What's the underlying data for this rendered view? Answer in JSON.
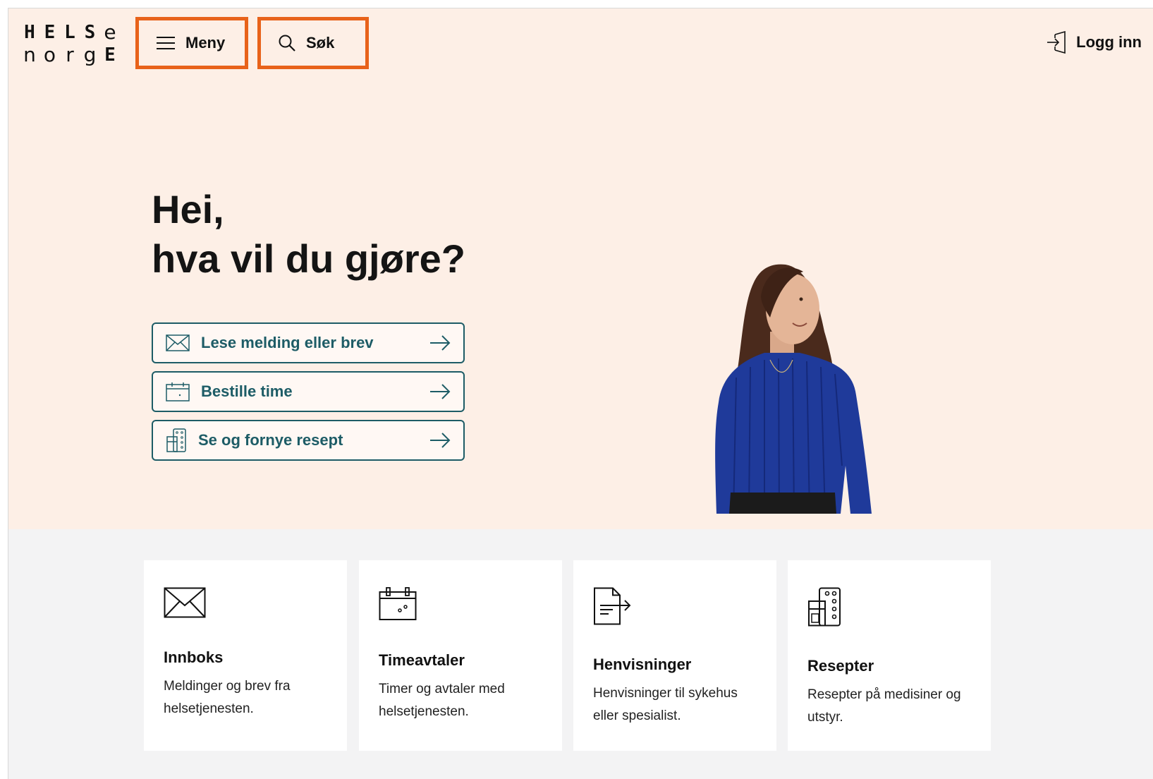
{
  "header": {
    "logo_top": [
      "H",
      "E",
      "L",
      "S",
      "e"
    ],
    "logo_bottom": [
      "n",
      "o",
      "r",
      "g",
      "E"
    ],
    "menu_label": "Meny",
    "search_label": "Søk",
    "login_label": "Logg inn"
  },
  "hero": {
    "greeting_line1": "Hei,",
    "greeting_line2": "hva vil du gjøre?",
    "actions": [
      {
        "label": "Lese melding eller brev",
        "icon": "envelope-icon"
      },
      {
        "label": "Bestille time",
        "icon": "calendar-icon"
      },
      {
        "label": "Se og fornye resept",
        "icon": "pill-icon"
      }
    ]
  },
  "cards": [
    {
      "title": "Innboks",
      "desc_line1": "Meldinger og brev fra",
      "desc_line2": "helsetjenesten.",
      "icon": "envelope-icon"
    },
    {
      "title": "Timeavtaler",
      "desc_line1": "Timer og avtaler med",
      "desc_line2": "helsetjenesten.",
      "icon": "calendar-icon"
    },
    {
      "title": "Henvisninger",
      "desc_line1": "Henvisninger til sykehus",
      "desc_line2": "eller spesialist.",
      "icon": "referral-icon"
    },
    {
      "title": "Resepter",
      "desc_line1": "Resepter på medisiner og",
      "desc_line2": "utstyr.",
      "icon": "prescription-icon"
    }
  ],
  "colors": {
    "hero_bg": "#fdefe6",
    "highlight": "#e8621a",
    "action_text": "#1d5c66",
    "lower_bg": "#f3f3f4"
  }
}
